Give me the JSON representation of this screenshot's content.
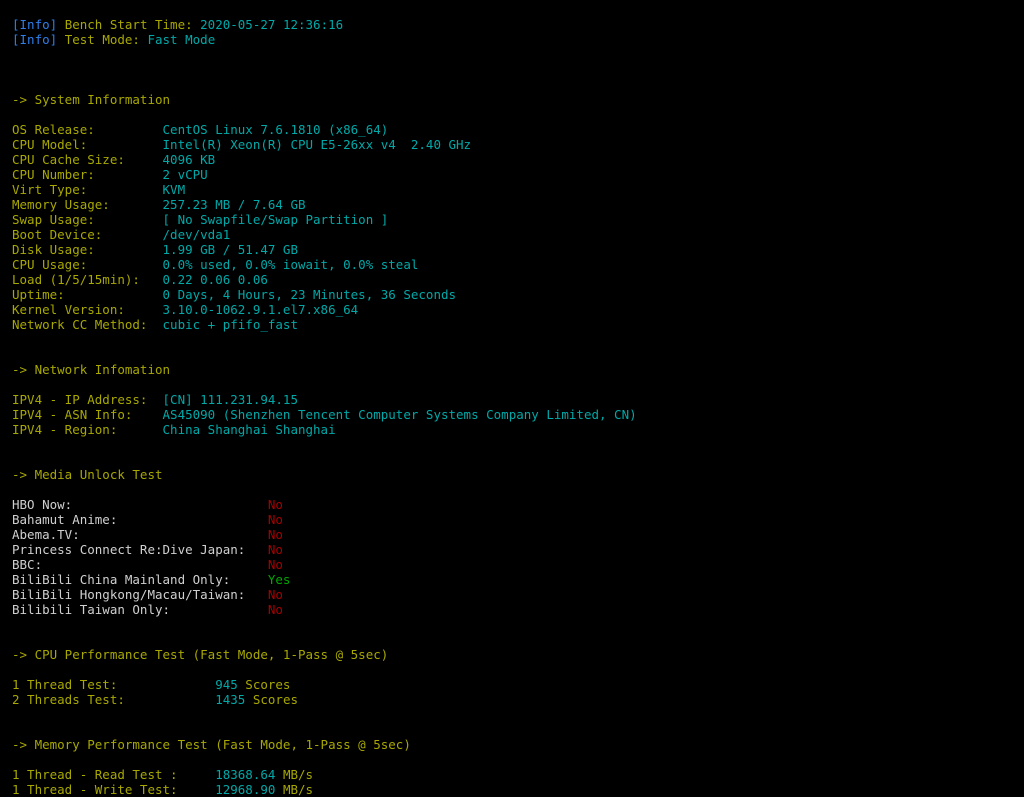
{
  "terminal": {
    "colors": {
      "background": "#000000",
      "info_tag": "#2f7fe8",
      "label": "#a8a800",
      "value": "#00a8a8",
      "plain": "#d0d0d0",
      "negative": "#a80000",
      "positive": "#00a800"
    },
    "info_lines": [
      {
        "tag": "[Info]",
        "label": "Bench Start Time:",
        "value": "2020-05-27 12:36:16"
      },
      {
        "tag": "[Info]",
        "label": "Test Mode:",
        "value": "Fast Mode"
      }
    ],
    "sections": [
      {
        "heading": "-> System Information",
        "rows": [
          {
            "label": "OS Release:",
            "value": "CentOS Linux 7.6.1810 (x86_64)"
          },
          {
            "label": "CPU Model:",
            "value": "Intel(R) Xeon(R) CPU E5-26xx v4  2.40 GHz"
          },
          {
            "label": "CPU Cache Size:",
            "value": "4096 KB"
          },
          {
            "label": "CPU Number:",
            "value": "2 vCPU"
          },
          {
            "label": "Virt Type:",
            "value": "KVM"
          },
          {
            "label": "Memory Usage:",
            "value": "257.23 MB / 7.64 GB"
          },
          {
            "label": "Swap Usage:",
            "value": "[ No Swapfile/Swap Partition ]"
          },
          {
            "label": "Boot Device:",
            "value": "/dev/vda1"
          },
          {
            "label": "Disk Usage:",
            "value": "1.99 GB / 51.47 GB"
          },
          {
            "label": "CPU Usage:",
            "value": "0.0% used, 0.0% iowait, 0.0% steal"
          },
          {
            "label": "Load (1/5/15min):",
            "value": "0.22 0.06 0.06"
          },
          {
            "label": "Uptime:",
            "value": "0 Days, 4 Hours, 23 Minutes, 36 Seconds"
          },
          {
            "label": "Kernel Version:",
            "value": "3.10.0-1062.9.1.el7.x86_64"
          },
          {
            "label": "Network CC Method:",
            "value": "cubic + pfifo_fast"
          }
        ]
      },
      {
        "heading": "-> Network Infomation",
        "rows": [
          {
            "label": "IPV4 - IP Address:",
            "value": "[CN] 111.231.94.15"
          },
          {
            "label": "IPV4 - ASN Info:",
            "value": "AS45090 (Shenzhen Tencent Computer Systems Company Limited, CN)"
          },
          {
            "label": "IPV4 - Region:",
            "value": "China Shanghai Shanghai"
          }
        ]
      },
      {
        "heading": "-> Media Unlock Test",
        "rows": [
          {
            "label": "HBO Now:",
            "value": "No",
            "state": "negative"
          },
          {
            "label": "Bahamut Anime:",
            "value": "No",
            "state": "negative"
          },
          {
            "label": "Abema.TV:",
            "value": "No",
            "state": "negative"
          },
          {
            "label": "Princess Connect Re:Dive Japan:",
            "value": "No",
            "state": "negative"
          },
          {
            "label": "BBC:",
            "value": "No",
            "state": "negative"
          },
          {
            "label": "BiliBili China Mainland Only:",
            "value": "Yes",
            "state": "positive"
          },
          {
            "label": "BiliBili Hongkong/Macau/Taiwan:",
            "value": "No",
            "state": "negative"
          },
          {
            "label": "Bilibili Taiwan Only:",
            "value": "No",
            "state": "negative"
          }
        ]
      },
      {
        "heading": "-> CPU Performance Test (Fast Mode, 1-Pass @ 5sec)",
        "rows": [
          {
            "label": "1 Thread Test:",
            "value": "945",
            "unit": "Scores"
          },
          {
            "label": "2 Threads Test:",
            "value": "1435",
            "unit": "Scores"
          }
        ]
      },
      {
        "heading": "-> Memory Performance Test (Fast Mode, 1-Pass @ 5sec)",
        "rows": [
          {
            "label": "1 Thread - Read Test :",
            "value": "18368.64",
            "unit": "MB/s"
          },
          {
            "label": "1 Thread - Write Test:",
            "value": "12968.90",
            "unit": "MB/s"
          }
        ]
      }
    ]
  }
}
